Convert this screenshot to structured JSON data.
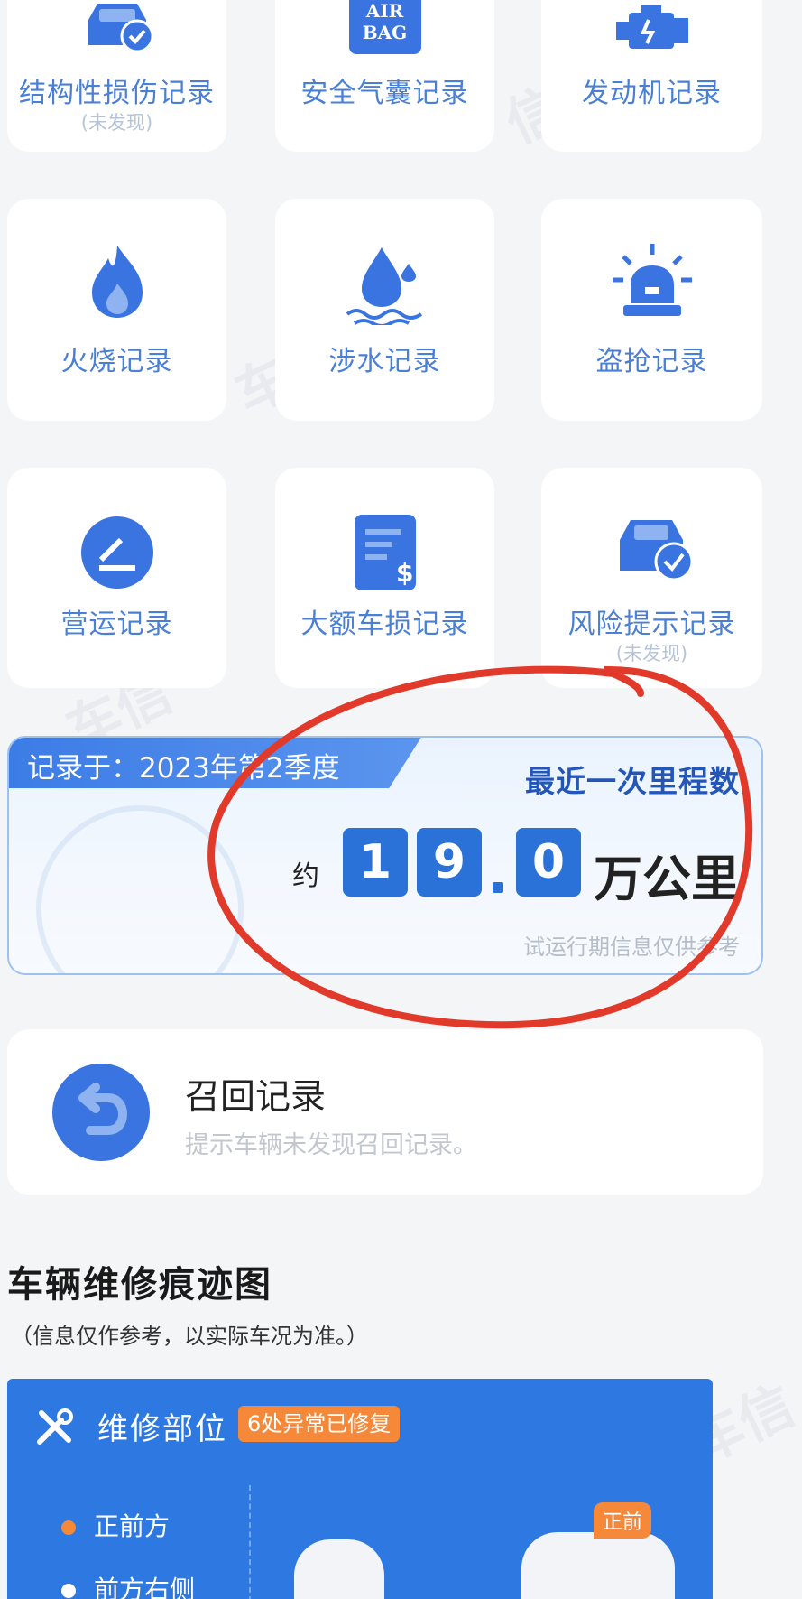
{
  "tiles": [
    {
      "label": "结构性损伤记录",
      "sub": "(未发现)",
      "icon": "car-check-icon"
    },
    {
      "label": "安全气囊记录",
      "sub": "",
      "icon": "airbag-icon",
      "icon_text": "AIR BAG"
    },
    {
      "label": "发动机记录",
      "sub": "",
      "icon": "engine-icon"
    },
    {
      "label": "火烧记录",
      "sub": "",
      "icon": "fire-icon"
    },
    {
      "label": "涉水记录",
      "sub": "",
      "icon": "water-icon"
    },
    {
      "label": "盗抢记录",
      "sub": "",
      "icon": "alarm-light-icon"
    },
    {
      "label": "营运记录",
      "sub": "",
      "icon": "edit-circle-icon"
    },
    {
      "label": "大额车损记录",
      "sub": "",
      "icon": "invoice-dollar-icon"
    },
    {
      "label": "风险提示记录",
      "sub": "(未发现)",
      "icon": "car-check-icon"
    }
  ],
  "mileage": {
    "recorded": "记录于：2023年第2季度",
    "title": "最近一次里程数",
    "approx": "约",
    "digits": [
      "1",
      "9",
      "0"
    ],
    "unit": "万公里",
    "note": "试运行期信息仅供参考"
  },
  "recall": {
    "title": "召回记录",
    "subtitle": "提示车辆未发现召回记录。",
    "icon": "undo-icon"
  },
  "repair_section": {
    "heading": "车辆维修痕迹图",
    "subheading": "（信息仅作参考，以实际车况为准。）",
    "panel_title": "维修部位",
    "badge": "6处异常已修复",
    "items": [
      {
        "label": "正前方",
        "color": "#f6883a"
      },
      {
        "label": "前方右侧",
        "color": "#ffffff"
      }
    ],
    "car_tag": "正前"
  },
  "colors": {
    "accent": "#2a72d8",
    "icon_blue": "#3a74e0",
    "orange": "#f6883a",
    "annotation_red": "#e23a2a"
  }
}
